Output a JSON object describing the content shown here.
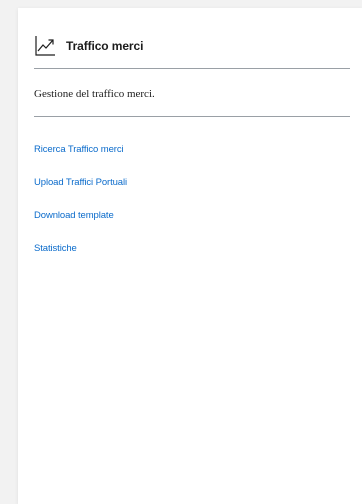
{
  "header": {
    "icon": "trend-chart-icon",
    "title": "Traffico merci"
  },
  "description": "Gestione del traffico merci.",
  "links": [
    {
      "label": "Ricerca Traffico merci"
    },
    {
      "label": "Upload Traffici Portuali"
    },
    {
      "label": "Download template"
    },
    {
      "label": "Statistiche"
    }
  ],
  "colors": {
    "link": "#0b6bcb",
    "text": "#1d1d1d",
    "divider": "#9aa0a6",
    "background": "#f2f2f2",
    "card": "#ffffff"
  }
}
